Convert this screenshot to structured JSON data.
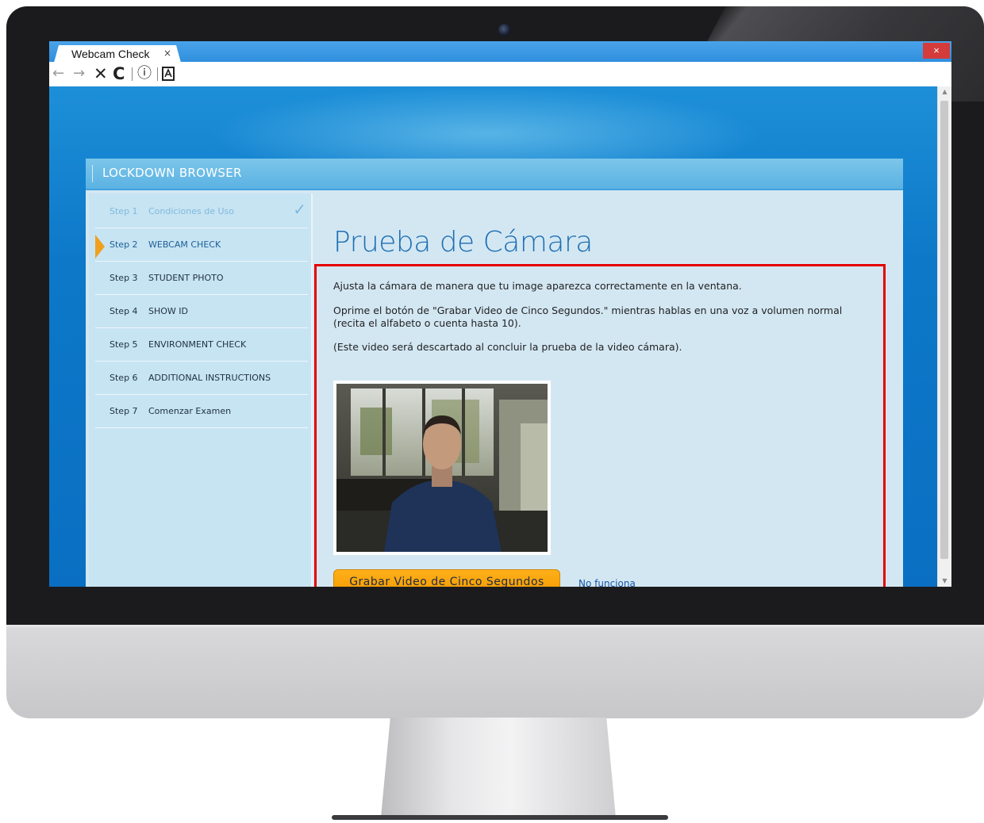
{
  "browser": {
    "tab_title": "Webcam Check",
    "tab_close": "×",
    "window_close": "×",
    "nav": {
      "back": "←",
      "forward": "→",
      "stop": "✕",
      "reload": "C",
      "info": "ⓘ"
    }
  },
  "app": {
    "title": "LOCKDOWN BROWSER"
  },
  "steps": [
    {
      "label": "Step 1",
      "name": "Condiciones de Uso",
      "state": "done",
      "check": "✓"
    },
    {
      "label": "Step 2",
      "name": "WEBCAM CHECK",
      "state": "active"
    },
    {
      "label": "Step 3",
      "name": "STUDENT PHOTO",
      "state": "pending"
    },
    {
      "label": "Step 4",
      "name": "SHOW ID",
      "state": "pending"
    },
    {
      "label": "Step 5",
      "name": "ENVIRONMENT CHECK",
      "state": "pending"
    },
    {
      "label": "Step 6",
      "name": "ADDITIONAL INSTRUCTIONS",
      "state": "pending"
    },
    {
      "label": "Step 7",
      "name": "Comenzar Examen",
      "state": "pending"
    }
  ],
  "main": {
    "heading": "Prueba de Cámara",
    "instructions": [
      "Ajusta la cámara de manera que tu image aparezca correctamente en la ventana.",
      "Oprime el botón de \"Grabar Video de Cinco Segundos.\" mientras hablas en una voz a volumen normal (recita el alfabeto o cuenta hasta 10).",
      "(Este video será descartado al concluir la prueba de la video cámara)."
    ],
    "record_button": "Grabar Video de Cinco Segundos",
    "not_working_link": "No funciona"
  },
  "colors": {
    "highlight_border": "#e60000",
    "button_orange": "#f39a00",
    "heading_blue": "#1e6fb3",
    "active_arrow": "#f0a020"
  }
}
